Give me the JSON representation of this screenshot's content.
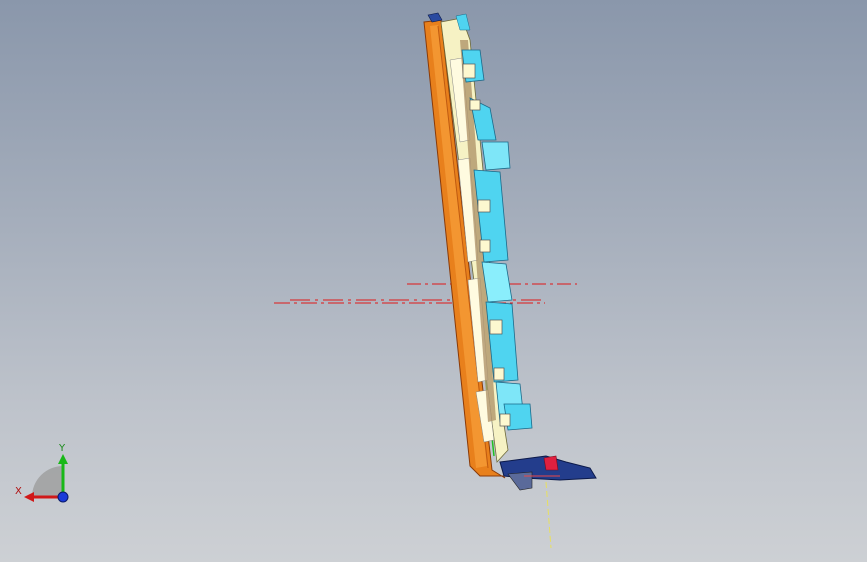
{
  "triad": {
    "x_label": "X",
    "y_label": "Y",
    "x_color": "#d01818",
    "y_color": "#18b818",
    "z_color": "#1a3ad8"
  },
  "colors": {
    "background_top": "#8a97ab",
    "background_bottom": "#cdd0d4",
    "shell_orange": "#e8801c",
    "cyan_parts": "#4fd4f0",
    "cream_parts": "#f6f2c4",
    "navy_parts": "#233d8c",
    "section_line_red": "#e01818",
    "axis_line_yellow": "#e8e060"
  }
}
